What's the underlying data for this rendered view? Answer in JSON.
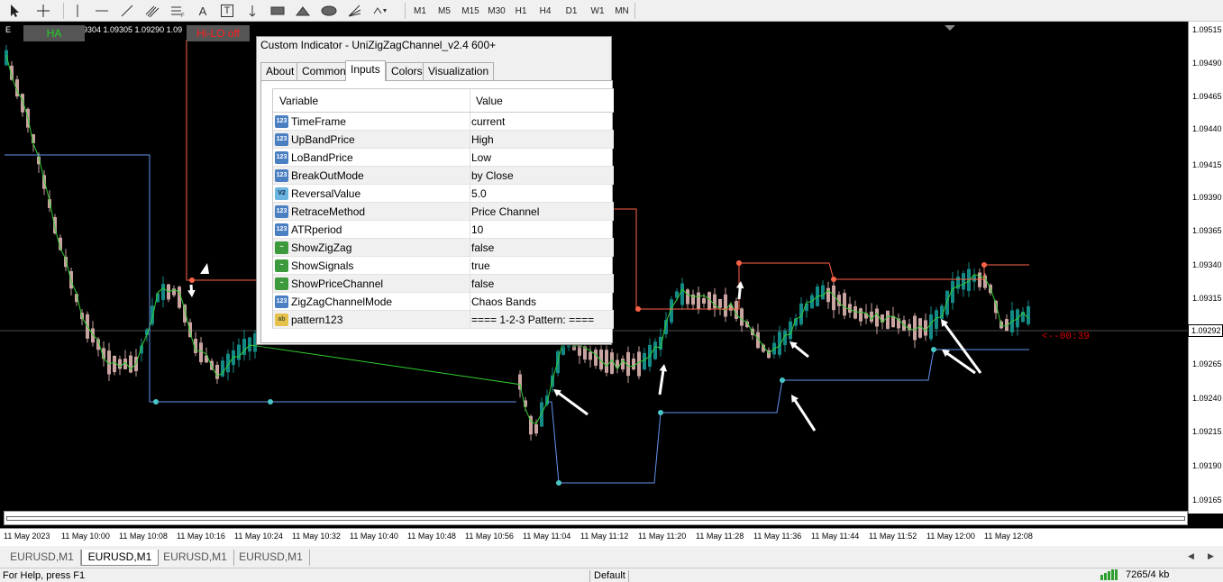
{
  "toolbar": {
    "timeframes": [
      "M1",
      "M5",
      "M15",
      "M30",
      "H1",
      "H4",
      "D1",
      "W1",
      "MN"
    ],
    "text_tool_label": "A",
    "label_tool_label": "T"
  },
  "chart": {
    "ohlc_text": "9304 1.09305 1.09290 1.09",
    "symbol_prefix": "E",
    "ha_button": "HA",
    "hilo_button": "Hi-LO off",
    "countdown": "<--00:39",
    "current_price": "1.09292",
    "price_labels": [
      "1.09515",
      "1.09490",
      "1.09465",
      "1.09440",
      "1.09415",
      "1.09390",
      "1.09365",
      "1.09340",
      "1.09315",
      "1.09265",
      "1.09240",
      "1.09215",
      "1.09190",
      "1.09165"
    ],
    "time_labels": [
      "11 May 2023",
      "11 May 10:00",
      "11 May 10:08",
      "11 May 10:16",
      "11 May 10:24",
      "11 May 10:32",
      "11 May 10:40",
      "11 May 10:48",
      "11 May 10:56",
      "11 May 11:04",
      "11 May 11:12",
      "11 May 11:20",
      "11 May 11:28",
      "11 May 11:36",
      "11 May 11:44",
      "11 May 11:52",
      "11 May 12:00",
      "11 May 12:08"
    ],
    "colors": {
      "bull_candle": "#138a86",
      "bear_candle": "#c9a3a0",
      "ha_line": "#32cd32",
      "upper_band": "#ff6347",
      "lower_band": "#6495ed",
      "background": "#000000"
    }
  },
  "dialog": {
    "title": "Custom Indicator - UniZigZagChannel_v2.4 600+",
    "tabs": [
      "About",
      "Common",
      "Inputs",
      "Colors",
      "Visualization"
    ],
    "active_tab": "Inputs",
    "columns": [
      "Variable",
      "Value"
    ],
    "inputs": [
      {
        "icon": "int-type-icon",
        "badge": "123",
        "name": "TimeFrame",
        "value": "current"
      },
      {
        "icon": "int-type-icon",
        "badge": "123",
        "name": "UpBandPrice",
        "value": "High"
      },
      {
        "icon": "int-type-icon",
        "badge": "123",
        "name": "LoBandPrice",
        "value": "Low"
      },
      {
        "icon": "int-type-icon",
        "badge": "123",
        "name": "BreakOutMode",
        "value": "by Close"
      },
      {
        "icon": "double-type-icon",
        "badge": "V2",
        "name": "ReversalValue",
        "value": "5.0"
      },
      {
        "icon": "int-type-icon",
        "badge": "123",
        "name": "RetraceMethod",
        "value": "Price Channel"
      },
      {
        "icon": "int-type-icon",
        "badge": "123",
        "name": "ATRperiod",
        "value": "10"
      },
      {
        "icon": "bool-type-icon",
        "badge": "~",
        "name": "ShowZigZag",
        "value": "false"
      },
      {
        "icon": "bool-type-icon",
        "badge": "~",
        "name": "ShowSignals",
        "value": "true"
      },
      {
        "icon": "bool-type-icon",
        "badge": "~",
        "name": "ShowPriceChannel",
        "value": "false"
      },
      {
        "icon": "int-type-icon",
        "badge": "123",
        "name": "ZigZagChannelMode",
        "value": "Chaos Bands"
      },
      {
        "icon": "string-type-icon",
        "badge": "ab",
        "name": "pattern123",
        "value": "==== 1-2-3 Pattern: ===="
      }
    ]
  },
  "symbol_tabs": [
    "EURUSD,M1",
    "EURUSD,M1",
    "EURUSD,M1",
    "EURUSD,M1"
  ],
  "active_symbol_tab": 1,
  "status": {
    "help": "For Help, press F1",
    "profile": "Default",
    "connection": "7265/4 kb"
  }
}
